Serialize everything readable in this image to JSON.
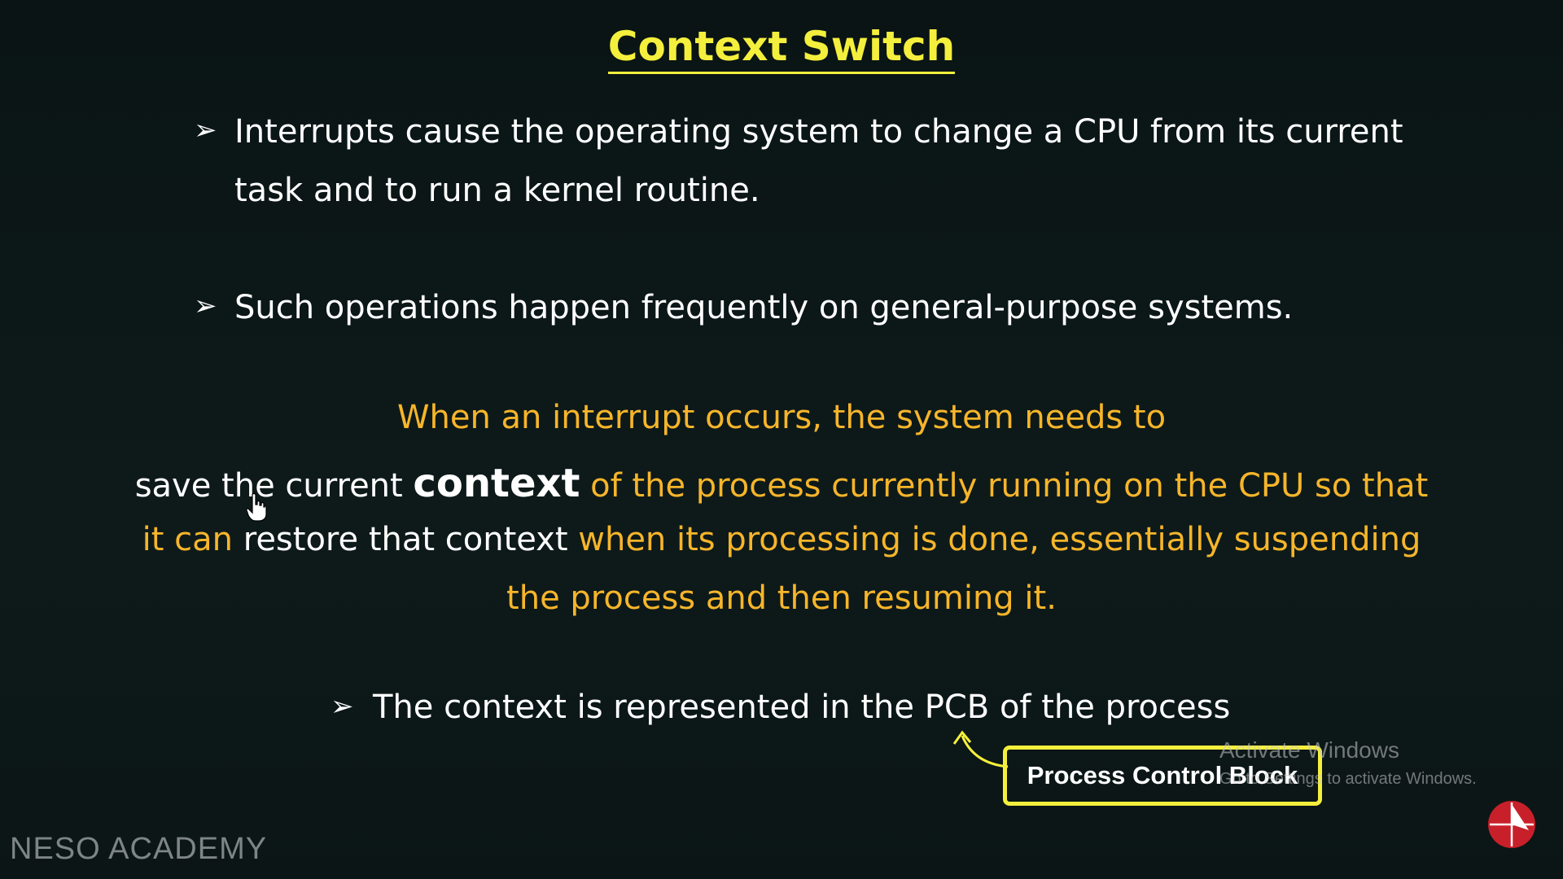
{
  "title": "Context Switch",
  "bullets": [
    {
      "line1": "Interrupts cause the operating system to change a CPU from its current",
      "line2": "task and to run a kernel routine."
    },
    {
      "line1": "Such operations happen frequently on general-purpose systems."
    },
    {
      "line1": "The context is represented in the PCB of the process"
    }
  ],
  "paragraph": {
    "line1": "When an interrupt occurs, the system needs to",
    "line2_white": "save the current ",
    "line2_bold": "context",
    "line2_rest": " of the process currently running on the CPU so that",
    "line3_yellow_a": "it can ",
    "line3_white": "restore that context",
    "line3_yellow_b": " when its processing is done, essentially suspending",
    "line4": "the process and then resuming it."
  },
  "pcb_label": "Process Control Block",
  "watermark": {
    "line1": "Activate Windows",
    "line2": "Go to Settings to activate Windows."
  },
  "brand": "NESO ACADEMY",
  "icons": {
    "bullet": "arrow-bullet-icon",
    "logo": "neso-logo-icon",
    "cursor": "hand-pointer-icon"
  },
  "colors": {
    "background": "#0d1616",
    "title": "#f4ef3c",
    "highlight": "#f6b52a",
    "box_border": "#f4ef3c",
    "logo": "#c8202a"
  }
}
